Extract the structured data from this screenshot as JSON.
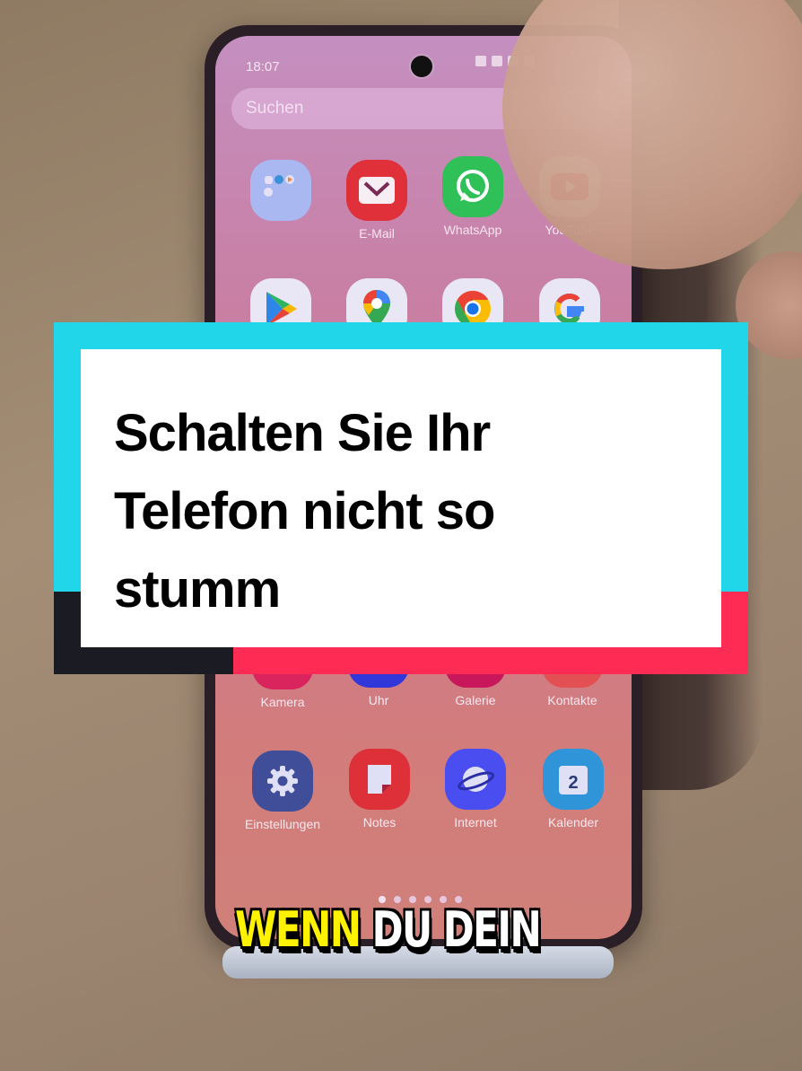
{
  "status_bar": {
    "time": "18:07"
  },
  "search": {
    "placeholder": "Suchen"
  },
  "apps": [
    {
      "name": "Folder",
      "label": "",
      "icon": "folder-icon",
      "color": "#a9b8f0"
    },
    {
      "name": "E-Mail",
      "label": "E-Mail",
      "icon": "mail-icon",
      "color": "#e0303a"
    },
    {
      "name": "WhatsApp",
      "label": "WhatsApp",
      "icon": "whatsapp-icon",
      "color": "#2fc158"
    },
    {
      "name": "YouTube",
      "label": "YouTube",
      "icon": "youtube-icon",
      "color": "#e9e6f5"
    },
    {
      "name": "Play Store",
      "label": "",
      "icon": "play-store-icon",
      "color": "#e9e6f5"
    },
    {
      "name": "Maps",
      "label": "",
      "icon": "maps-icon",
      "color": "#e9e6f5"
    },
    {
      "name": "Chrome",
      "label": "",
      "icon": "chrome-icon",
      "color": "#e9e6f5"
    },
    {
      "name": "Google",
      "label": "",
      "icon": "google-icon",
      "color": "#e9e6f5"
    },
    {
      "name": "Kamera",
      "label": "Kamera",
      "icon": "camera-icon",
      "color": "#d9245e"
    },
    {
      "name": "Uhr",
      "label": "Uhr",
      "icon": "clock-icon",
      "color": "#3137d8"
    },
    {
      "name": "Galerie",
      "label": "Galerie",
      "icon": "gallery-icon",
      "color": "#c8175a"
    },
    {
      "name": "Kontakte",
      "label": "Kontakte",
      "icon": "contacts-icon",
      "color": "#e35053"
    },
    {
      "name": "Einstellungen",
      "label": "Einstellungen",
      "icon": "settings-gear-icon",
      "color": "#404e9a"
    },
    {
      "name": "Notes",
      "label": "Notes",
      "icon": "notes-icon",
      "color": "#dd3038"
    },
    {
      "name": "Internet",
      "label": "Internet",
      "icon": "internet-planet-icon",
      "color": "#4a4ef0"
    },
    {
      "name": "Kalender",
      "label": "Kalender",
      "icon": "calendar-icon",
      "color": "#2f95d8",
      "badge": "2"
    }
  ],
  "page_indicator": {
    "pages": 6,
    "current": 1
  },
  "overlay": {
    "line1": "Schalten Sie Ihr",
    "line2": "Telefon nicht so",
    "line3": "stumm",
    "colors": {
      "cyan": "#22d6ea",
      "red": "#fe2c55",
      "dark": "#1b1b24"
    }
  },
  "caption": {
    "highlight": "WENN",
    "rest": " DU DEIN",
    "highlight_color": "#fff200"
  }
}
